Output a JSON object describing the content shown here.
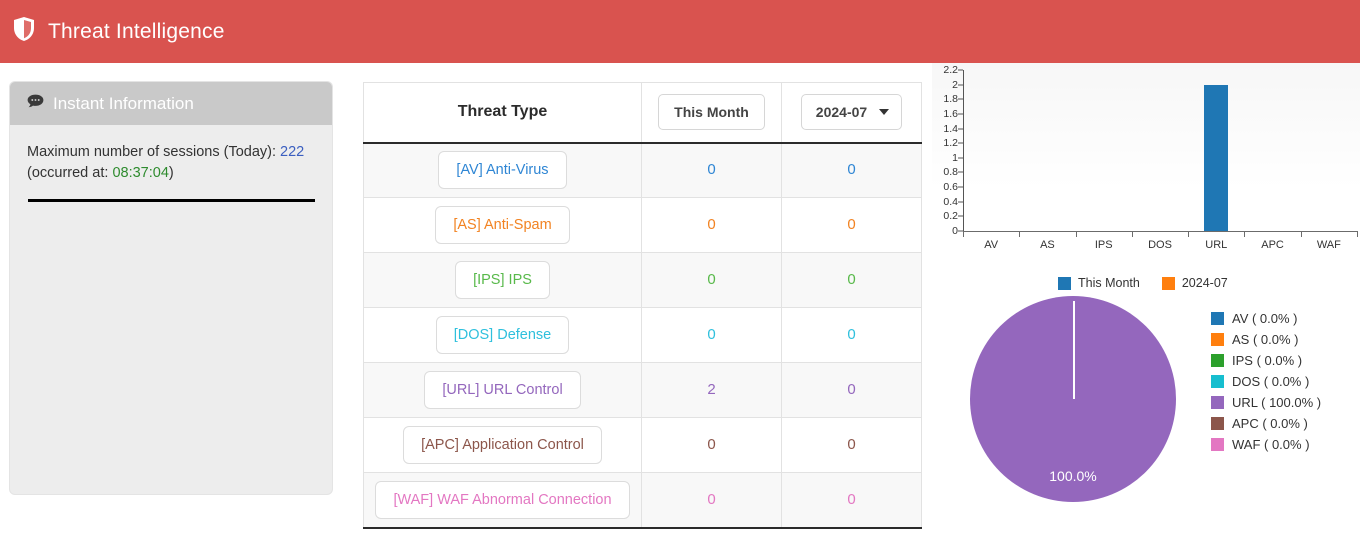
{
  "header": {
    "title": "Threat Intelligence",
    "icon": "shield-icon",
    "background_color": "#d9534f"
  },
  "info_panel": {
    "icon": "speech-bubble-icon",
    "title": "Instant Information",
    "sessions_label": "Maximum number of sessions (Today):",
    "sessions_value": "222",
    "sessions_value_color": "#3b5fc0",
    "occurred_prefix": "(occurred at:",
    "occurred_value": "08:37:04",
    "occurred_suffix": ")",
    "occurred_value_color": "#2e8b2e"
  },
  "table": {
    "columns": {
      "type": "Threat Type",
      "this_month": "This Month",
      "month_select": "2024-07"
    },
    "rows": [
      {
        "label": "[AV] Anti-Virus",
        "color": "#2f86d4",
        "this_month": "0",
        "month": "0"
      },
      {
        "label": "[AS] Anti-Spam",
        "color": "#f28322",
        "this_month": "0",
        "month": "0"
      },
      {
        "label": "[IPS] IPS",
        "color": "#58b94a",
        "this_month": "0",
        "month": "0"
      },
      {
        "label": "[DOS] Defense",
        "color": "#2fc0dd",
        "this_month": "0",
        "month": "0"
      },
      {
        "label": "[URL] URL Control",
        "color": "#9467bd",
        "this_month": "2",
        "month": "0"
      },
      {
        "label": "[APC] Application Control",
        "color": "#8c564b",
        "this_month": "0",
        "month": "0"
      },
      {
        "label": "[WAF] WAF Abnormal Connection",
        "color": "#e377c2",
        "this_month": "0",
        "month": "0"
      }
    ]
  },
  "chart_data": [
    {
      "type": "bar",
      "title": "",
      "categories": [
        "AV",
        "AS",
        "IPS",
        "DOS",
        "URL",
        "APC",
        "WAF"
      ],
      "series": [
        {
          "name": "This Month",
          "color": "#1f77b4",
          "values": [
            0,
            0,
            0,
            0,
            2,
            0,
            0
          ]
        },
        {
          "name": "2024-07",
          "color": "#ff7f0e",
          "values": [
            0,
            0,
            0,
            0,
            0,
            0,
            0
          ]
        }
      ],
      "xlabel": "",
      "ylabel": "",
      "ylim": [
        0,
        2.2
      ],
      "yticks": [
        "0",
        "0.2",
        "0.4",
        "0.6",
        "0.8",
        "1",
        "1.2",
        "1.4",
        "1.6",
        "1.8",
        "2",
        "2.2"
      ],
      "grid": false,
      "legend_position": "bottom"
    },
    {
      "type": "pie",
      "title": "",
      "labels": [
        "AV",
        "AS",
        "IPS",
        "DOS",
        "URL",
        "APC",
        "WAF"
      ],
      "values": [
        0.0,
        0.0,
        0.0,
        0.0,
        100.0,
        0.0,
        0.0
      ],
      "colors": [
        "#1f77b4",
        "#ff7f0e",
        "#2ca02c",
        "#17becf",
        "#9467bd",
        "#8c564b",
        "#e377c2"
      ],
      "legend": [
        "AV ( 0.0% )",
        "AS ( 0.0% )",
        "IPS ( 0.0% )",
        "DOS ( 0.0% )",
        "URL ( 100.0% )",
        "APC ( 0.0% )",
        "WAF ( 0.0% )"
      ],
      "slice_label": "100.0%",
      "legend_position": "right"
    }
  ]
}
